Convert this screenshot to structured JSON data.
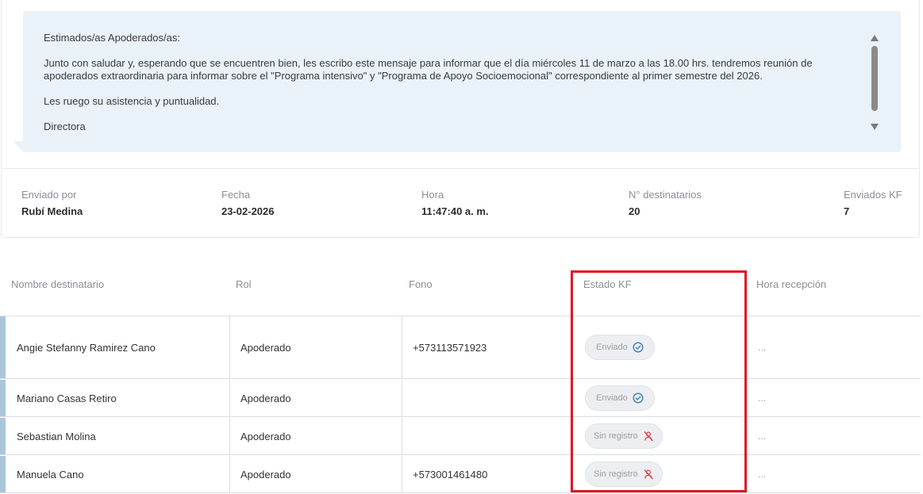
{
  "message": {
    "greeting": "Estimados/as Apoderados/as:",
    "body": "Junto con saludar y, esperando que se encuentren bien, les escribo este mensaje para informar que el día miércoles 11 de marzo a las 18.00 hrs. tendremos reunión de apoderados extraordinaria para informar sobre el \"Programa intensivo\" y \"Programa de Apoyo Socioemocional\" correspondiente al primer semestre del 2026.",
    "request": "Les ruego su asistencia y puntualidad.",
    "signature": "Directora"
  },
  "meta": {
    "sent_by": {
      "label": "Enviado por",
      "value": "Rubí Medina"
    },
    "date": {
      "label": "Fecha",
      "value": "23-02-2026"
    },
    "time": {
      "label": "Hora",
      "value": "11:47:40 a. m."
    },
    "recipients": {
      "label": "N° destinatarios",
      "value": "20"
    },
    "sent_kf": {
      "label": "Enviados KF",
      "value": "7"
    }
  },
  "table": {
    "headers": {
      "name": "Nombre destinatario",
      "role": "Rol",
      "phone": "Fono",
      "status": "Estado KF",
      "received": "Hora recepción"
    },
    "rows": [
      {
        "name": "Angie Stefanny Ramirez Cano",
        "role": "Apoderado",
        "phone": "+573113571923",
        "status": "Enviado",
        "status_icon": "check-circle-icon",
        "received": "..."
      },
      {
        "name": "Mariano Casas Retiro",
        "role": "Apoderado",
        "phone": "",
        "status": "Enviado",
        "status_icon": "check-circle-icon",
        "received": "..."
      },
      {
        "name": "Sebastian Molina",
        "role": "Apoderado",
        "phone": "",
        "status": "Sin registro",
        "status_icon": "no-user-icon",
        "received": "..."
      },
      {
        "name": "Manuela Cano",
        "role": "Apoderado",
        "phone": "+573001461480",
        "status": "Sin registro",
        "status_icon": "no-user-icon",
        "received": "..."
      }
    ]
  },
  "colors": {
    "bubble_bg": "#e9f2f8",
    "row_accent": "#a9c6d8",
    "check_icon": "#3d7fb8",
    "no_user_icon": "#e0414b",
    "highlight": "#e0141e"
  }
}
